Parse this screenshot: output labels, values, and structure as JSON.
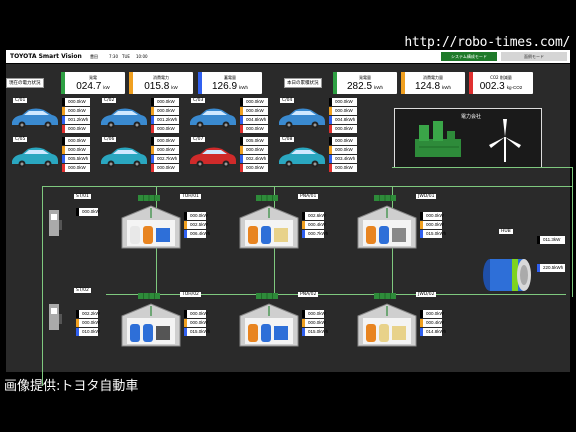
{
  "watermark": "http://robo-times.com/",
  "credit": "画像提供:トヨタ自動車",
  "header": {
    "app_title": "TOYOTA Smart Vision",
    "location": "豊田",
    "time": "7:30",
    "day": "TUE",
    "extra": "10:00",
    "mode_system": "システム構成モード",
    "mode_sim": "面倒モード"
  },
  "current_power": {
    "label": "現在の電力状況",
    "meters": [
      {
        "label": "発電",
        "value": "024.7",
        "unit": "kW",
        "color": "#2ea043"
      },
      {
        "label": "消費電力",
        "value": "015.8",
        "unit": "kW",
        "color": "#f0a020"
      },
      {
        "label": "蓄電量",
        "value": "126.9",
        "unit": "kWh",
        "color": "#3060f0"
      }
    ]
  },
  "daily_totals": {
    "label": "本日の累積状況",
    "meters": [
      {
        "label": "発電量",
        "value": "282.5",
        "unit": "kWh",
        "color": "#2ea043"
      },
      {
        "label": "消費電力量",
        "value": "124.8",
        "unit": "kWh",
        "color": "#f0a020"
      },
      {
        "label": "CO2 削減量",
        "value": "002.3",
        "unit": "kg-CO2",
        "color": "#e03030"
      }
    ]
  },
  "vehicles": [
    {
      "id": "C/01",
      "color": "#3a8ad0",
      "values": [
        "000.0kW",
        "000.0kW",
        "001.2kWh",
        "000.0kW"
      ]
    },
    {
      "id": "C/02",
      "color": "#3a8ad0",
      "values": [
        "000.0kW",
        "000.0kW",
        "001.2kWh",
        "000.0kW"
      ]
    },
    {
      "id": "C/03",
      "color": "#3a8ad0",
      "values": [
        "000.0kW",
        "000.0kW",
        "004.8kWh",
        "000.0kW"
      ]
    },
    {
      "id": "C/04",
      "color": "#3a8ad0",
      "values": [
        "000.0kW",
        "000.0kW",
        "004.8kWh",
        "000.0kW"
      ]
    },
    {
      "id": "C/05",
      "color": "#2aa7c0",
      "values": [
        "000.0kW",
        "000.0kW",
        "005.5kWh",
        "000.0kW"
      ]
    },
    {
      "id": "C/06",
      "color": "#2aa7c0",
      "values": [
        "000.0kW",
        "000.0kW",
        "002.7kWh",
        "000.0kW"
      ]
    },
    {
      "id": "C/07",
      "color": "#d02a2a",
      "values": [
        "005.0kW",
        "000.0kW",
        "002.4kWh",
        "000.0kW"
      ]
    },
    {
      "id": "C/08",
      "color": "#2aa7c0",
      "values": [
        "000.0kW",
        "000.0kW",
        "003.4kWh",
        "000.0kW"
      ]
    }
  ],
  "power_company": {
    "label": "電力会社"
  },
  "stations": [
    {
      "id": "ST/01",
      "values": [
        "000.0kW"
      ]
    },
    {
      "id": "ST/02",
      "values": [
        "002.2kW",
        "000.0kW",
        "010.0kW"
      ]
    }
  ],
  "buildings": [
    {
      "id": "TOH/01",
      "values": [
        "000.0kW",
        "002.5kW",
        "006.4kWh"
      ]
    },
    {
      "id": "PNA/01",
      "values": [
        "002.6kW",
        "000.4kW",
        "000.7kWh"
      ]
    },
    {
      "id": "JWD/01",
      "values": [
        "000.0kW",
        "000.0kW",
        "015.0kWh"
      ]
    },
    {
      "id": "TOH/02",
      "values": [
        "000.0kW",
        "000.0kW",
        "015.0kWh"
      ]
    },
    {
      "id": "PNA/02",
      "values": [
        "000.0kW",
        "000.0kW",
        "015.0kWh"
      ]
    },
    {
      "id": "JWD/02",
      "values": [
        "000.0kW",
        "000.4kW",
        "014.8kWh"
      ]
    }
  ],
  "hub": {
    "id": "HUB",
    "values": [
      "011.3kW",
      "220.5kWh"
    ]
  }
}
